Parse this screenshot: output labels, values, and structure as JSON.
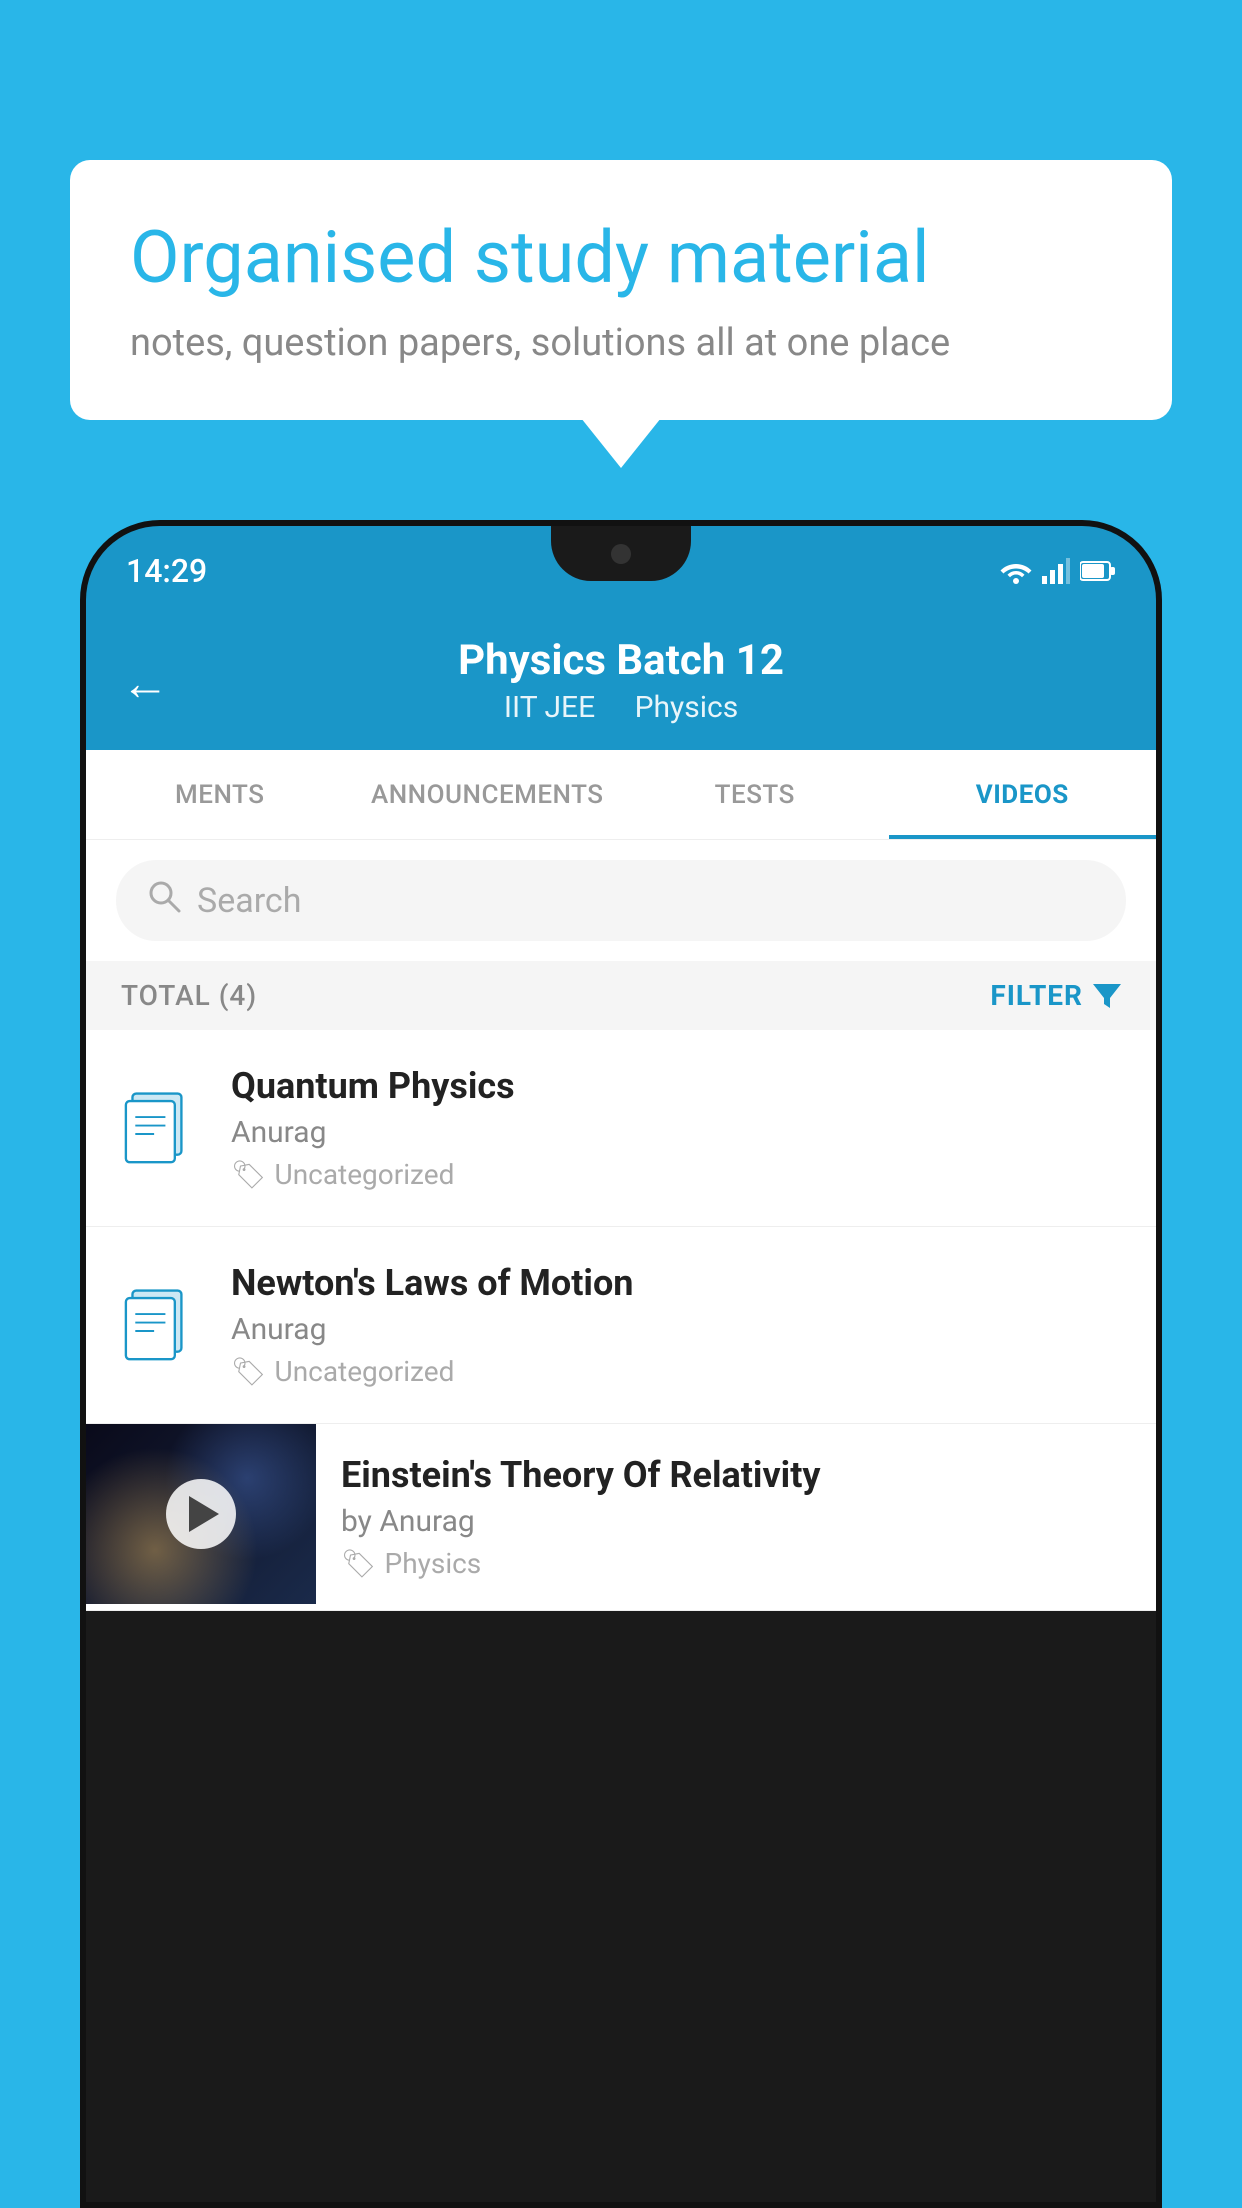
{
  "page": {
    "background_color": "#29b6e8"
  },
  "speech_bubble": {
    "heading": "Organised study material",
    "subtext": "notes, question papers, solutions all at one place"
  },
  "status_bar": {
    "time": "14:29"
  },
  "app_header": {
    "title": "Physics Batch 12",
    "subtitle_part1": "IIT JEE",
    "subtitle_part2": "Physics",
    "back_label": "←"
  },
  "tabs": [
    {
      "label": "MENTS",
      "active": false
    },
    {
      "label": "ANNOUNCEMENTS",
      "active": false
    },
    {
      "label": "TESTS",
      "active": false
    },
    {
      "label": "VIDEOS",
      "active": true
    }
  ],
  "search": {
    "placeholder": "Search"
  },
  "filter_row": {
    "total_label": "TOTAL (4)",
    "filter_label": "FILTER"
  },
  "video_items": [
    {
      "id": 1,
      "title": "Quantum Physics",
      "author": "Anurag",
      "tag": "Uncategorized",
      "has_thumbnail": false
    },
    {
      "id": 2,
      "title": "Newton's Laws of Motion",
      "author": "Anurag",
      "tag": "Uncategorized",
      "has_thumbnail": false
    },
    {
      "id": 3,
      "title": "Einstein's Theory Of Relativity",
      "author": "by Anurag",
      "tag": "Physics",
      "has_thumbnail": true
    }
  ]
}
